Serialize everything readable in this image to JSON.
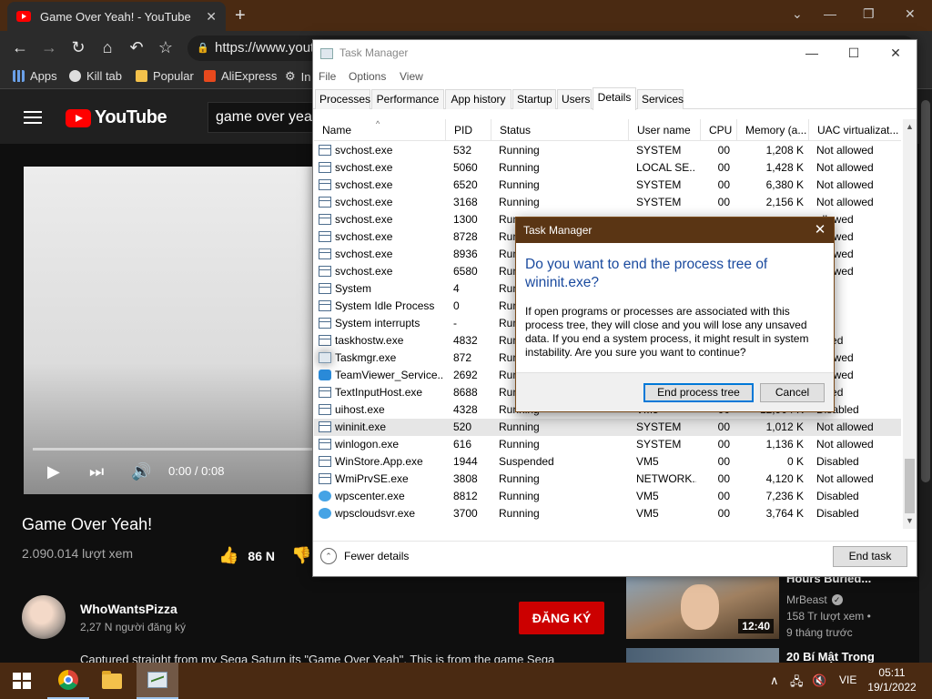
{
  "browser": {
    "tab_title": "Game Over Yeah! - YouTube",
    "new_tab": "+",
    "url": "https://www.yout",
    "bookmarks": [
      "Apps",
      "Kill tab",
      "Popular",
      "AliExpress",
      "In"
    ]
  },
  "youtube": {
    "logo_text": "YouTube",
    "search_value": "game over yeah",
    "player_time": "0:00 / 0:08",
    "video_title": "Game Over Yeah!",
    "views": "2.090.014 lượt xem",
    "likes": "86 N",
    "channel_name": "WhoWantsPizza",
    "subscribers": "2,27 N người đăng ký",
    "subscribe_label": "ĐĂNG KÝ",
    "description": "Captured straight from my Sega Saturn its \"Game Over Yeah\". This is from the game Sega",
    "suggestions": [
      {
        "title": "Hours Buried...",
        "channel": "MrBeast",
        "views": "158 Tr lượt xem",
        "age": "9 tháng trước",
        "duration": "12:40"
      },
      {
        "title": "20 Bí Mật Trong"
      }
    ]
  },
  "task_manager": {
    "title": "Task Manager",
    "menu": [
      "File",
      "Options",
      "View"
    ],
    "tabs": [
      "Processes",
      "Performance",
      "App history",
      "Startup",
      "Users",
      "Details",
      "Services"
    ],
    "selected_tab": "Details",
    "columns": [
      "Name",
      "PID",
      "Status",
      "User name",
      "CPU",
      "Memory (a...",
      "UAC virtualizat..."
    ],
    "rows": [
      {
        "name": "svchost.exe",
        "pid": "532",
        "status": "Running",
        "user": "SYSTEM",
        "cpu": "00",
        "mem": "1,208 K",
        "uac": "Not allowed"
      },
      {
        "name": "svchost.exe",
        "pid": "5060",
        "status": "Running",
        "user": "LOCAL SE...",
        "cpu": "00",
        "mem": "1,428 K",
        "uac": "Not allowed"
      },
      {
        "name": "svchost.exe",
        "pid": "6520",
        "status": "Running",
        "user": "SYSTEM",
        "cpu": "00",
        "mem": "6,380 K",
        "uac": "Not allowed"
      },
      {
        "name": "svchost.exe",
        "pid": "3168",
        "status": "Running",
        "user": "SYSTEM",
        "cpu": "00",
        "mem": "2,156 K",
        "uac": "Not allowed"
      },
      {
        "name": "svchost.exe",
        "pid": "1300",
        "status": "Run",
        "user": "",
        "cpu": "",
        "mem": "",
        "uac": "allowed"
      },
      {
        "name": "svchost.exe",
        "pid": "8728",
        "status": "Run",
        "user": "",
        "cpu": "",
        "mem": "",
        "uac": "allowed"
      },
      {
        "name": "svchost.exe",
        "pid": "8936",
        "status": "Run",
        "user": "",
        "cpu": "",
        "mem": "",
        "uac": "allowed"
      },
      {
        "name": "svchost.exe",
        "pid": "6580",
        "status": "Run",
        "user": "",
        "cpu": "",
        "mem": "",
        "uac": "allowed"
      },
      {
        "name": "System",
        "pid": "4",
        "status": "Run",
        "user": "",
        "cpu": "",
        "mem": "",
        "uac": ""
      },
      {
        "name": "System Idle Process",
        "pid": "0",
        "status": "Run",
        "user": "",
        "cpu": "",
        "mem": "",
        "uac": ""
      },
      {
        "name": "System interrupts",
        "pid": "-",
        "status": "Run",
        "user": "",
        "cpu": "",
        "mem": "",
        "uac": ""
      },
      {
        "name": "taskhostw.exe",
        "pid": "4832",
        "status": "Run",
        "user": "",
        "cpu": "",
        "mem": "",
        "uac": "abled"
      },
      {
        "name": "Taskmgr.exe",
        "pid": "872",
        "status": "Run",
        "user": "",
        "cpu": "",
        "mem": "",
        "uac": "allowed"
      },
      {
        "name": "TeamViewer_Service....",
        "pid": "2692",
        "status": "Run",
        "user": "",
        "cpu": "",
        "mem": "",
        "uac": "allowed"
      },
      {
        "name": "TextInputHost.exe",
        "pid": "8688",
        "status": "Run",
        "user": "",
        "cpu": "",
        "mem": "",
        "uac": "abled"
      },
      {
        "name": "uihost.exe",
        "pid": "4328",
        "status": "Running",
        "user": "VM5",
        "cpu": "00",
        "mem": "12,904 K",
        "uac": "Disabled"
      },
      {
        "name": "wininit.exe",
        "pid": "520",
        "status": "Running",
        "user": "SYSTEM",
        "cpu": "00",
        "mem": "1,012 K",
        "uac": "Not allowed"
      },
      {
        "name": "winlogon.exe",
        "pid": "616",
        "status": "Running",
        "user": "SYSTEM",
        "cpu": "00",
        "mem": "1,136 K",
        "uac": "Not allowed"
      },
      {
        "name": "WinStore.App.exe",
        "pid": "1944",
        "status": "Suspended",
        "user": "VM5",
        "cpu": "00",
        "mem": "0 K",
        "uac": "Disabled"
      },
      {
        "name": "WmiPrvSE.exe",
        "pid": "3808",
        "status": "Running",
        "user": "NETWORK...",
        "cpu": "00",
        "mem": "4,120 K",
        "uac": "Not allowed"
      },
      {
        "name": "wpscenter.exe",
        "pid": "8812",
        "status": "Running",
        "user": "VM5",
        "cpu": "00",
        "mem": "7,236 K",
        "uac": "Disabled"
      },
      {
        "name": "wpscloudsvr.exe",
        "pid": "3700",
        "status": "Running",
        "user": "VM5",
        "cpu": "00",
        "mem": "3,764 K",
        "uac": "Disabled"
      }
    ],
    "selected_row": "wininit.exe",
    "fewer_details": "Fewer details",
    "end_task": "End task"
  },
  "dialog": {
    "title": "Task Manager",
    "heading": "Do you want to end the process tree of wininit.exe?",
    "body": "If open programs or processes are associated with this process tree, they will close and you will lose any unsaved data. If you end a system process, it might result in system instability. Are you sure you want to continue?",
    "confirm": "End process tree",
    "cancel": "Cancel"
  },
  "taskbar": {
    "language": "VIE",
    "time": "05:11",
    "date": "19/1/2022"
  },
  "icons": {
    "youtube": "youtube-logo-icon",
    "chrome": "chrome-icon",
    "explorer": "file-explorer-icon",
    "taskmgr": "task-manager-icon"
  },
  "colors": {
    "accent_brown": "#4a2a12",
    "dialog_title": "#1a4a9e",
    "subscribe_red": "#cc0000"
  }
}
